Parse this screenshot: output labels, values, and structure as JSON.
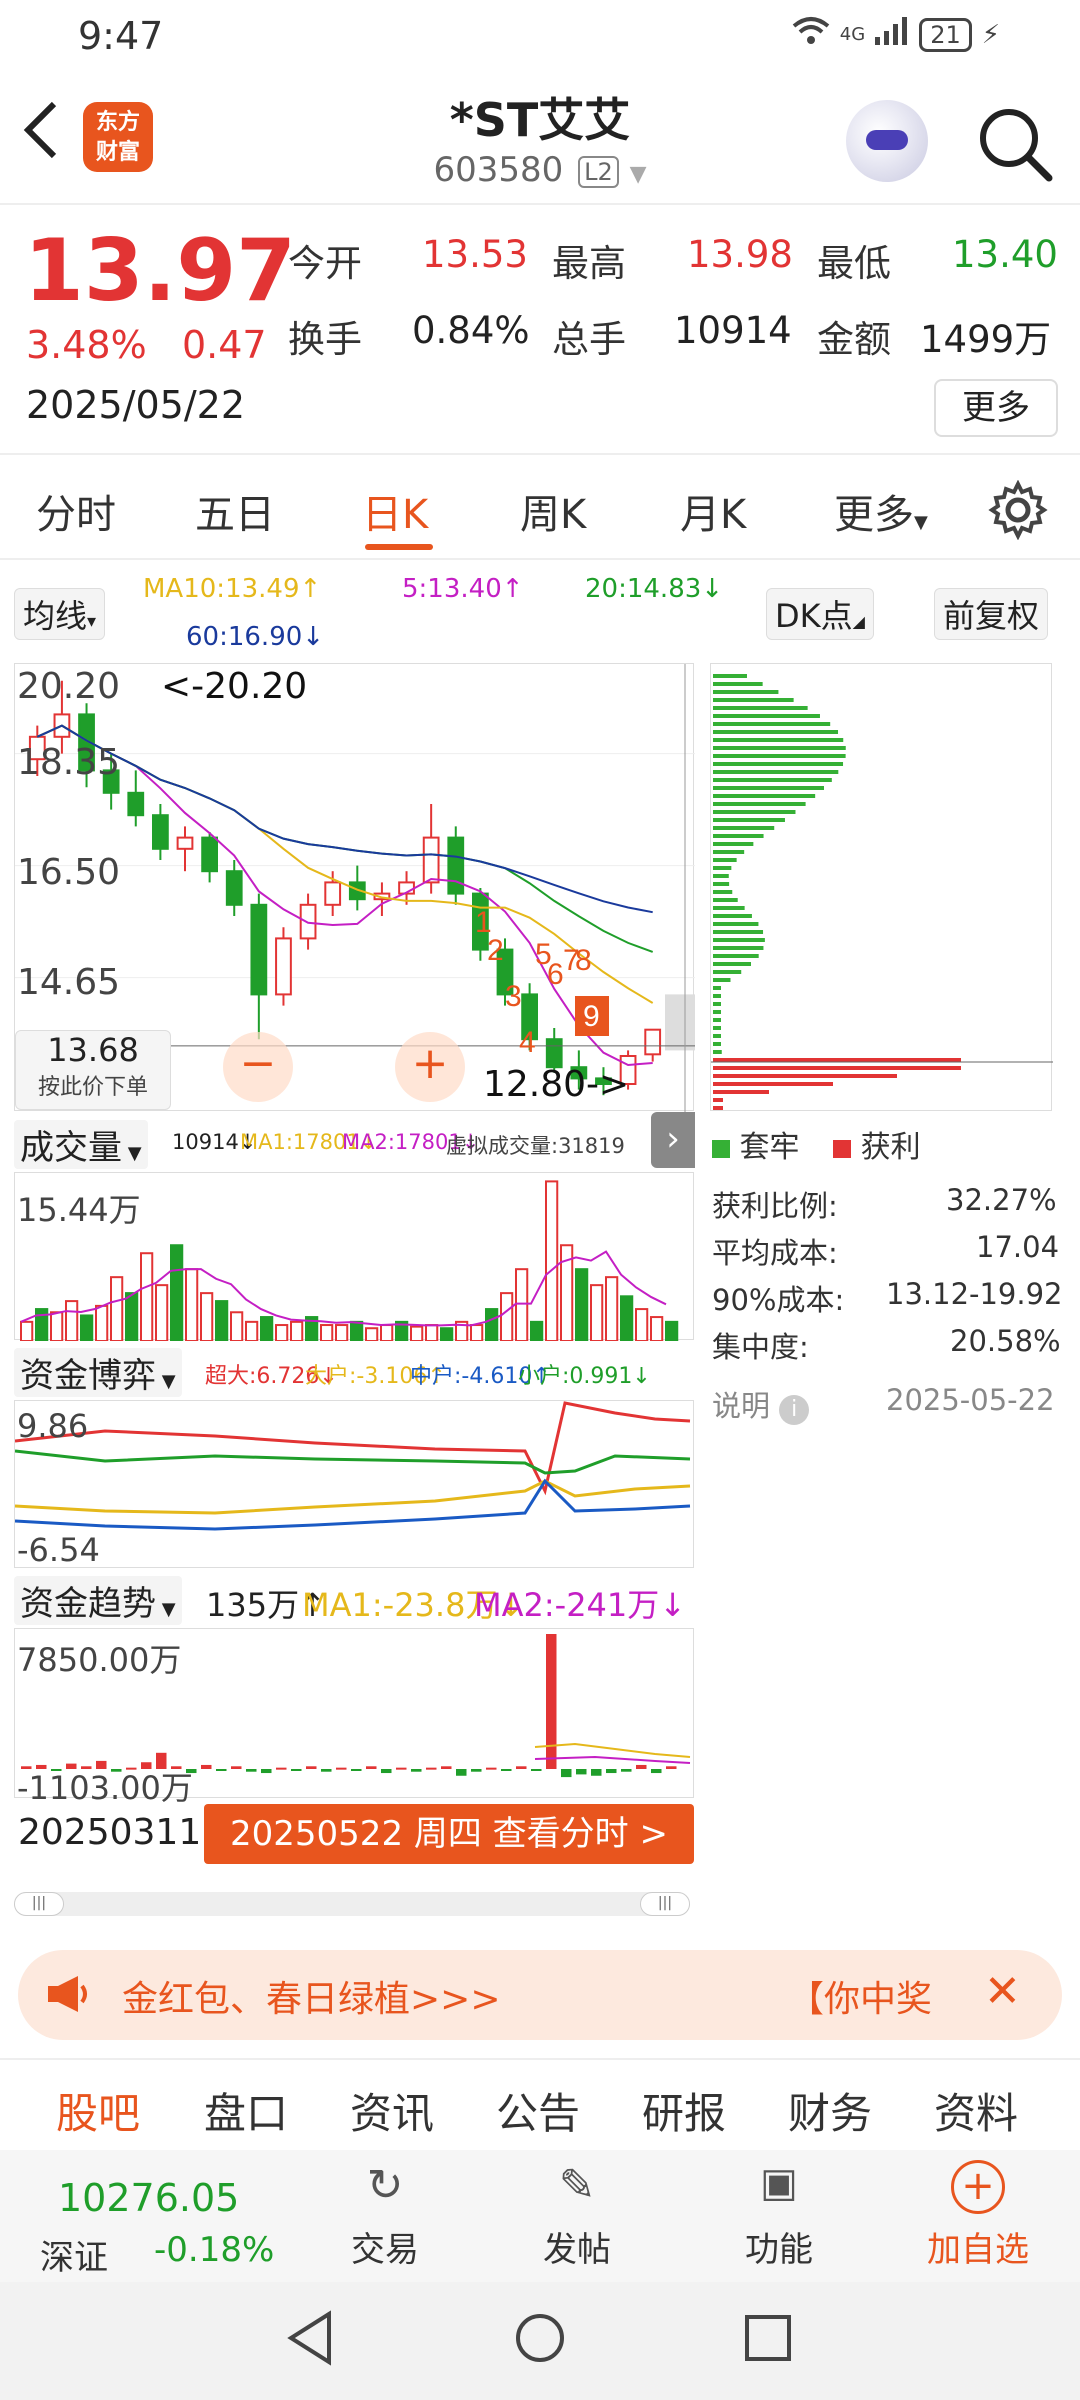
{
  "status_bar": {
    "time": "9:47",
    "network": "4G",
    "battery": "21"
  },
  "header": {
    "stock_name": "*ST艾艾",
    "stock_code": "603580",
    "level": "L2",
    "logo_line1": "东方",
    "logo_line2": "财富"
  },
  "quote": {
    "price": "13.97",
    "change_pct": "3.48%",
    "change": "0.47",
    "date": "2025/05/22",
    "open_label": "今开",
    "open": "13.53",
    "high_label": "最高",
    "high": "13.98",
    "low_label": "最低",
    "low": "13.40",
    "turnover_label": "换手",
    "turnover": "0.84%",
    "volume_label": "总手",
    "volume": "10914",
    "amount_label": "金额",
    "amount": "1499万",
    "more_label": "更多"
  },
  "tabs": [
    "分时",
    "五日",
    "日K",
    "周K",
    "月K",
    "更多"
  ],
  "ma_bar": {
    "ma_button": "均线",
    "ma10": "MA10:13.49↑",
    "ma5": "5:13.40↑",
    "ma20": "20:14.83↓",
    "ma60": "60:16.90↓",
    "dk_button": "DK点",
    "adjust_button": "前复权"
  },
  "kchart": {
    "y_ticks": [
      "20.20",
      "18.35",
      "16.50",
      "14.65"
    ],
    "max_label": "<-20.20",
    "min_label": "12.80->",
    "crosshair_price": "13.68",
    "crosshair_hint": "按此价下单",
    "markers": [
      "1",
      "2",
      "3",
      "4",
      "5",
      "6",
      "7",
      "8",
      "9"
    ]
  },
  "chip": {
    "legend_trapped": "套牢",
    "legend_profit": "获利",
    "profit_ratio_label": "获利比例:",
    "profit_ratio": "32.27%",
    "avg_cost_label": "平均成本:",
    "avg_cost": "17.04",
    "cost90_label": "90%成本:",
    "cost90": "13.12-19.92",
    "concentration_label": "集中度:",
    "concentration": "20.58%",
    "explain_label": "说明",
    "explain_date": "2025-05-22"
  },
  "volume_panel": {
    "label": "成交量",
    "vol": "10914↓",
    "ma1": "MA1:17801↓",
    "ma2": "MA2:17801↓",
    "virtual": "虚拟成交量:31819",
    "max": "15.44万"
  },
  "capital_game": {
    "label": "资金博弈",
    "super": "超大:6.726↓",
    "large": "大户:-3.106↑",
    "mid": "中户:-4.610↑",
    "small": "小户:0.991↓",
    "top": "9.86",
    "bottom": "-6.54"
  },
  "capital_trend": {
    "label": "资金趋势",
    "value": "135万↑",
    "ma1": "MA1:-23.8万↓",
    "ma2": "MA2:-241万↓",
    "top": "7850.00万",
    "bottom": "-1103.00万"
  },
  "date_bar": {
    "start": "20250311",
    "current": "20250522 周四 查看分时 >"
  },
  "banner": {
    "text": "金红包、春日绿植>>>",
    "right_text": "【你中奖"
  },
  "bottom_tabs": [
    "股吧",
    "盘口",
    "资讯",
    "公告",
    "研报",
    "财务",
    "资料"
  ],
  "dock": {
    "index_value": "10276.05",
    "index_name": "深证",
    "index_change": "-0.18%",
    "trade": "交易",
    "post": "发帖",
    "function": "功能",
    "add_watch": "加自选"
  },
  "chart_data": [
    {
      "type": "candlestick",
      "title": "日K",
      "candles_approx": [
        {
          "o": 18.8,
          "h": 19.4,
          "l": 18.5,
          "c": 19.2
        },
        {
          "o": 19.2,
          "h": 20.2,
          "l": 18.9,
          "c": 19.6
        },
        {
          "o": 19.6,
          "h": 19.8,
          "l": 18.3,
          "c": 18.6
        },
        {
          "o": 18.6,
          "h": 18.9,
          "l": 17.9,
          "c": 18.2
        },
        {
          "o": 18.2,
          "h": 18.6,
          "l": 17.6,
          "c": 17.8
        },
        {
          "o": 17.8,
          "h": 18.0,
          "l": 17.0,
          "c": 17.2
        },
        {
          "o": 17.2,
          "h": 17.6,
          "l": 16.8,
          "c": 17.4
        },
        {
          "o": 17.4,
          "h": 17.5,
          "l": 16.6,
          "c": 16.8
        },
        {
          "o": 16.8,
          "h": 17.0,
          "l": 16.0,
          "c": 16.2
        },
        {
          "o": 16.2,
          "h": 16.4,
          "l": 13.8,
          "c": 14.6
        },
        {
          "o": 14.6,
          "h": 15.8,
          "l": 14.4,
          "c": 15.6
        },
        {
          "o": 15.6,
          "h": 16.4,
          "l": 15.4,
          "c": 16.2
        },
        {
          "o": 16.2,
          "h": 16.8,
          "l": 16.0,
          "c": 16.6
        },
        {
          "o": 16.6,
          "h": 16.9,
          "l": 16.1,
          "c": 16.3
        },
        {
          "o": 16.3,
          "h": 16.6,
          "l": 16.0,
          "c": 16.4
        },
        {
          "o": 16.4,
          "h": 16.8,
          "l": 16.2,
          "c": 16.6
        },
        {
          "o": 16.6,
          "h": 18.0,
          "l": 16.4,
          "c": 17.4
        },
        {
          "o": 17.4,
          "h": 17.6,
          "l": 16.2,
          "c": 16.4
        },
        {
          "o": 16.4,
          "h": 16.5,
          "l": 15.2,
          "c": 15.4
        },
        {
          "o": 15.4,
          "h": 15.6,
          "l": 14.4,
          "c": 14.6
        },
        {
          "o": 14.6,
          "h": 14.8,
          "l": 13.6,
          "c": 13.8
        },
        {
          "o": 13.8,
          "h": 14.0,
          "l": 13.2,
          "c": 13.3
        },
        {
          "o": 13.3,
          "h": 13.6,
          "l": 12.9,
          "c": 13.1
        },
        {
          "o": 13.1,
          "h": 13.3,
          "l": 12.8,
          "c": 13.0
        },
        {
          "o": 13.0,
          "h": 13.6,
          "l": 12.9,
          "c": 13.5
        },
        {
          "o": 13.53,
          "h": 13.98,
          "l": 13.4,
          "c": 13.97
        }
      ],
      "ylim": [
        12.5,
        20.5
      ]
    }
  ]
}
